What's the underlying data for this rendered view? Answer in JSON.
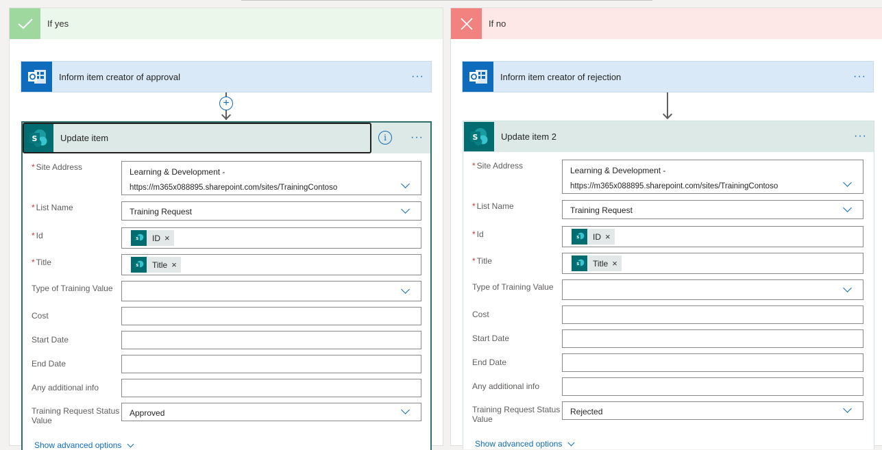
{
  "branches": {
    "yes": {
      "title": "If yes",
      "action": {
        "title": "Inform item creator of approval",
        "more": "···"
      },
      "card": {
        "title": "Update item",
        "more": "···",
        "info": "i",
        "fields": {
          "site_address": {
            "label": "Site Address",
            "line1": "Learning & Development -",
            "line2": "https://m365x088895.sharepoint.com/sites/TrainingContoso"
          },
          "list_name": {
            "label": "List Name",
            "value": "Training Request"
          },
          "id": {
            "label": "Id",
            "token": "ID"
          },
          "title": {
            "label": "Title",
            "token": "Title"
          },
          "type_of_training": {
            "label": "Type of Training Value",
            "value": ""
          },
          "cost": {
            "label": "Cost",
            "value": ""
          },
          "start_date": {
            "label": "Start Date",
            "value": ""
          },
          "end_date": {
            "label": "End Date",
            "value": ""
          },
          "additional_info": {
            "label": "Any additional info",
            "value": ""
          },
          "status": {
            "label": "Training Request Status Value",
            "value": "Approved"
          }
        },
        "advanced": "Show advanced options"
      }
    },
    "no": {
      "title": "If no",
      "action": {
        "title": "Inform item creator of rejection",
        "more": "···"
      },
      "card": {
        "title": "Update item 2",
        "more": "···",
        "fields": {
          "site_address": {
            "label": "Site Address",
            "line1": "Learning & Development -",
            "line2": "https://m365x088895.sharepoint.com/sites/TrainingContoso"
          },
          "list_name": {
            "label": "List Name",
            "value": "Training Request"
          },
          "id": {
            "label": "Id",
            "token": "ID"
          },
          "title": {
            "label": "Title",
            "token": "Title"
          },
          "type_of_training": {
            "label": "Type of Training Value",
            "value": ""
          },
          "cost": {
            "label": "Cost",
            "value": ""
          },
          "start_date": {
            "label": "Start Date",
            "value": ""
          },
          "end_date": {
            "label": "End Date",
            "value": ""
          },
          "additional_info": {
            "label": "Any additional info",
            "value": ""
          },
          "status": {
            "label": "Training Request Status Value",
            "value": "Rejected"
          }
        },
        "advanced": "Show advanced options"
      }
    }
  },
  "common": {
    "required_mark": "*",
    "remove_mark": "×",
    "plus": "+"
  },
  "icons": {
    "checkmark": "checkmark-icon",
    "close": "close-icon",
    "outlook": "outlook-icon",
    "sharepoint": "sharepoint-icon",
    "info": "info-icon",
    "chevron": "chevron-down-icon"
  },
  "colors": {
    "accent": "#0f6cbd",
    "yes_header": "#eaf7ea",
    "yes_badge": "#9fd89f",
    "no_header": "#fde7e7",
    "no_badge": "#f1827f",
    "sharepoint": "#036c70",
    "outlook": "#0f6cbd"
  }
}
